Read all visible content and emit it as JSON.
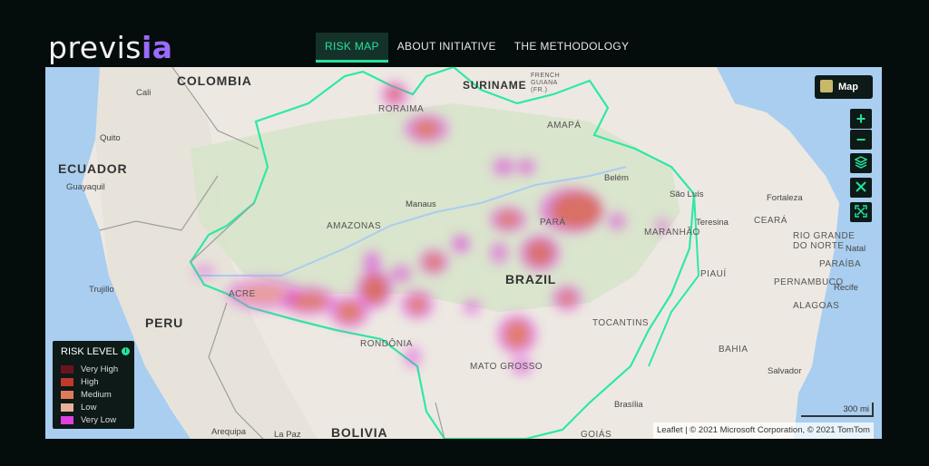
{
  "brand": {
    "logo_text": "previs",
    "logo_accent": "ia"
  },
  "nav": {
    "tabs": [
      {
        "label": "RISK MAP",
        "active": true
      },
      {
        "label": "ABOUT INITIATIVE",
        "active": false
      },
      {
        "label": "THE METHODOLOGY",
        "active": false
      }
    ]
  },
  "map": {
    "layer_button_label": "Map",
    "controls": [
      {
        "name": "zoom-in-button",
        "icon": "plus-icon"
      },
      {
        "name": "zoom-out-button",
        "icon": "minus-icon"
      },
      {
        "name": "layers-button",
        "icon": "layers-icon"
      },
      {
        "name": "tools-button",
        "icon": "tools-icon"
      },
      {
        "name": "fullscreen-button",
        "icon": "expand-icon"
      }
    ],
    "scale_label": "300 mi",
    "attribution": "Leaflet | © 2021 Microsoft Corporation, © 2021 TomTom",
    "countries": [
      "COLOMBIA",
      "ECUADOR",
      "PERU",
      "BOLIVIA",
      "BRAZIL",
      "SURINAME"
    ],
    "states": [
      "RORAIMA",
      "AMAPÁ",
      "AMAZONAS",
      "PARÁ",
      "MARANHÃO",
      "PIAUÍ",
      "CEARÁ",
      "RIO GRANDE DO NORTE",
      "PARAÍBA",
      "PERNAMBUCO",
      "ALAGOAS",
      "BAHIA",
      "TOCANTINS",
      "MATO GROSSO",
      "RONDÔNIA",
      "ACRE",
      "GOIÁS",
      "FRENCH GUIANA (FR.)"
    ],
    "cities": [
      "Cali",
      "Quito",
      "Guayaquil",
      "Trujillo",
      "Arequipa",
      "La Paz",
      "Manaus",
      "Belém",
      "São Luís",
      "Fortaleza",
      "Teresina",
      "Natal",
      "Recife",
      "Salvador",
      "Brasília"
    ]
  },
  "legend": {
    "title": "RISK LEVEL",
    "items": [
      {
        "label": "Very High",
        "color": "#6b1420"
      },
      {
        "label": "High",
        "color": "#c0392b"
      },
      {
        "label": "Medium",
        "color": "#e07a5a"
      },
      {
        "label": "Low",
        "color": "#e8b09a"
      },
      {
        "label": "Very Low",
        "color": "#e040e0"
      }
    ]
  },
  "colors": {
    "accent": "#25e29a",
    "brand": "#9b6bff"
  }
}
